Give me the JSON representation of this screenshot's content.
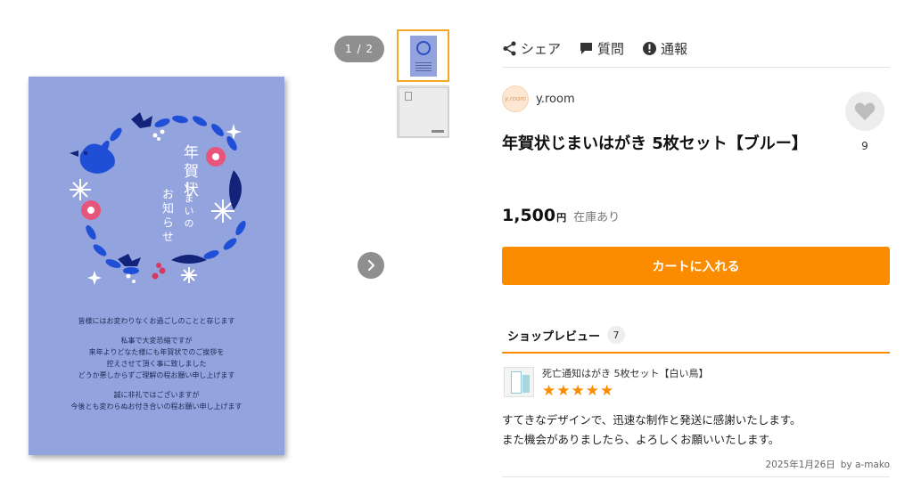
{
  "gallery": {
    "page_indicator": "1 / 2",
    "card": {
      "vertical_title_1": "年賀状",
      "vertical_title_2": "じまいの",
      "vertical_title_3": "お知らせ",
      "message_lines": [
        "皆様にはお変わりなくお過ごしのことと存じます",
        "私事で大変恐縮ですが",
        "来年よりどなた様にも年賀状でのご挨拶を",
        "控えさせて頂く事に致しました",
        "どうか悪しからずご理解の程お願い申し上げます",
        "誠に非礼ではございますが",
        "今後とも変わらぬお付き合いの程お願い申し上げます"
      ],
      "background_color": "#93a3de"
    }
  },
  "actions": {
    "share": "シェア",
    "question": "質問",
    "report": "通報"
  },
  "shop": {
    "name": "y.room",
    "avatar_text": "y.room"
  },
  "favorite": {
    "count": "9"
  },
  "product": {
    "title": "年賀状じまいはがき 5枚セット【ブルー】",
    "price": "1,500",
    "currency": "円",
    "stock": "在庫あり"
  },
  "cart": {
    "label": "カートに入れる",
    "color": "#fb8c00"
  },
  "reviews": {
    "heading": "ショップレビュー",
    "count": "7",
    "item": {
      "product_name": "死亡通知はがき 5枚セット【白い鳥】",
      "stars": "★★★★★",
      "rating": 5,
      "text_line_1": "すてきなデザインで、迅速な制作と発送に感謝いたします。",
      "text_line_2": "また機会がありましたら、よろしくお願いいたします。",
      "date": "2025年1月26日",
      "author": "by a-mako"
    }
  }
}
